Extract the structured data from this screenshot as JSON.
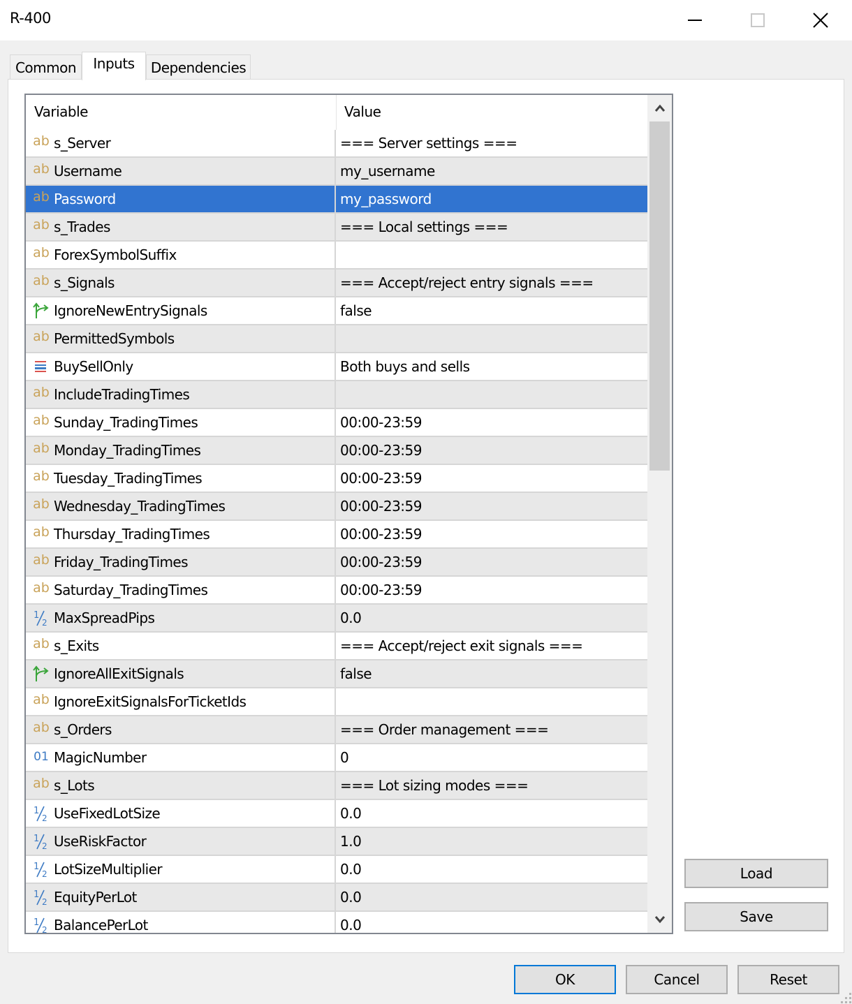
{
  "window": {
    "title": "R-400",
    "controls": {
      "minimize": "minimize",
      "maximize": "maximize",
      "close": "close"
    }
  },
  "tabs": [
    {
      "label": "Common",
      "active": false
    },
    {
      "label": "Inputs",
      "active": true
    },
    {
      "label": "Dependencies",
      "active": false
    }
  ],
  "grid": {
    "columns": [
      "Variable",
      "Value"
    ],
    "selected_index": 2,
    "rows": [
      {
        "type": "string",
        "icon": "ab",
        "variable": "s_Server",
        "value": "=== Server settings ==="
      },
      {
        "type": "string",
        "icon": "ab",
        "variable": "Username",
        "value": "my_username"
      },
      {
        "type": "string",
        "icon": "ab",
        "variable": "Password",
        "value": "my_password"
      },
      {
        "type": "string",
        "icon": "ab",
        "variable": "s_Trades",
        "value": "=== Local settings ==="
      },
      {
        "type": "string",
        "icon": "ab",
        "variable": "ForexSymbolSuffix",
        "value": ""
      },
      {
        "type": "string",
        "icon": "ab",
        "variable": "s_Signals",
        "value": "=== Accept/reject entry signals ==="
      },
      {
        "type": "bool",
        "icon": "branch",
        "variable": "IgnoreNewEntrySignals",
        "value": "false"
      },
      {
        "type": "string",
        "icon": "ab",
        "variable": "PermittedSymbols",
        "value": ""
      },
      {
        "type": "enum",
        "icon": "enum",
        "variable": "BuySellOnly",
        "value": "Both buys and sells"
      },
      {
        "type": "string",
        "icon": "ab",
        "variable": "IncludeTradingTimes",
        "value": ""
      },
      {
        "type": "string",
        "icon": "ab",
        "variable": "Sunday_TradingTimes",
        "value": "00:00-23:59"
      },
      {
        "type": "string",
        "icon": "ab",
        "variable": "Monday_TradingTimes",
        "value": "00:00-23:59"
      },
      {
        "type": "string",
        "icon": "ab",
        "variable": "Tuesday_TradingTimes",
        "value": "00:00-23:59"
      },
      {
        "type": "string",
        "icon": "ab",
        "variable": "Wednesday_TradingTimes",
        "value": "00:00-23:59"
      },
      {
        "type": "string",
        "icon": "ab",
        "variable": "Thursday_TradingTimes",
        "value": "00:00-23:59"
      },
      {
        "type": "string",
        "icon": "ab",
        "variable": "Friday_TradingTimes",
        "value": "00:00-23:59"
      },
      {
        "type": "string",
        "icon": "ab",
        "variable": "Saturday_TradingTimes",
        "value": "00:00-23:59"
      },
      {
        "type": "double",
        "icon": "half",
        "variable": "MaxSpreadPips",
        "value": "0.0"
      },
      {
        "type": "string",
        "icon": "ab",
        "variable": "s_Exits",
        "value": "=== Accept/reject exit signals ==="
      },
      {
        "type": "bool",
        "icon": "branch",
        "variable": "IgnoreAllExitSignals",
        "value": "false"
      },
      {
        "type": "string",
        "icon": "ab",
        "variable": "IgnoreExitSignalsForTicketIds",
        "value": ""
      },
      {
        "type": "string",
        "icon": "ab",
        "variable": "s_Orders",
        "value": "=== Order management ==="
      },
      {
        "type": "int",
        "icon": "01",
        "variable": "MagicNumber",
        "value": "0"
      },
      {
        "type": "string",
        "icon": "ab",
        "variable": "s_Lots",
        "value": "=== Lot sizing modes ==="
      },
      {
        "type": "double",
        "icon": "half",
        "variable": "UseFixedLotSize",
        "value": "0.0"
      },
      {
        "type": "double",
        "icon": "half",
        "variable": "UseRiskFactor",
        "value": "1.0"
      },
      {
        "type": "double",
        "icon": "half",
        "variable": "LotSizeMultiplier",
        "value": "0.0"
      },
      {
        "type": "double",
        "icon": "half",
        "variable": "EquityPerLot",
        "value": "0.0"
      },
      {
        "type": "double",
        "icon": "half",
        "variable": "BalancePerLot",
        "value": "0.0"
      }
    ]
  },
  "side_buttons": {
    "load": "Load",
    "save": "Save"
  },
  "footer_buttons": {
    "ok": "OK",
    "cancel": "Cancel",
    "reset": "Reset"
  },
  "colors": {
    "selection": "#3174d0",
    "string_icon": "#c9a35a",
    "number_icon": "#3e7bc4",
    "bool_icon": "#3aa53a",
    "default_button_border": "#0078d7"
  }
}
